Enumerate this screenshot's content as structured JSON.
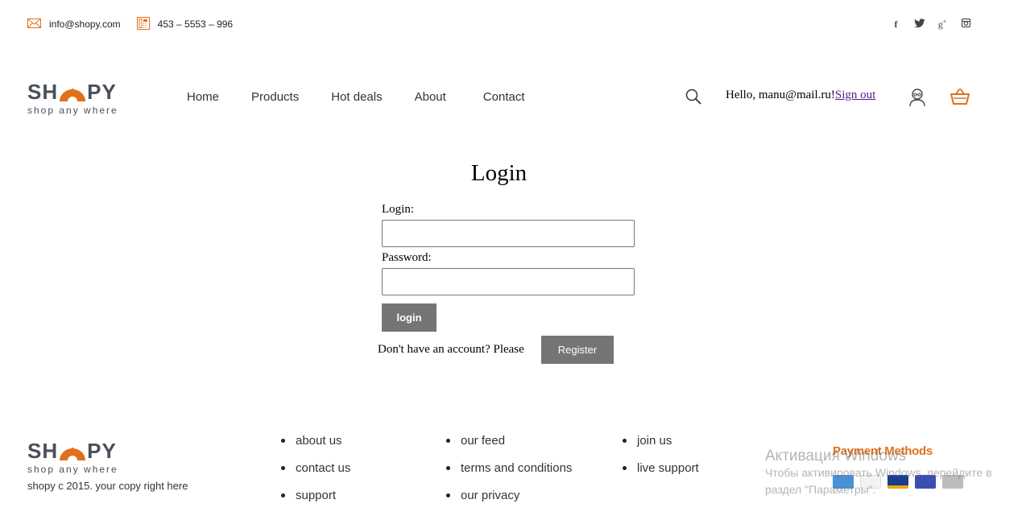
{
  "topbar": {
    "email": "info@shopy.com",
    "phone": "453 – 5553 – 996",
    "email_icon": "envelope-icon",
    "phone_icon": "phone-icon",
    "social": [
      {
        "name": "facebook-icon",
        "glyph": "f"
      },
      {
        "name": "twitter-icon",
        "glyph": "t"
      },
      {
        "name": "google-plus-icon",
        "glyph": "g+"
      },
      {
        "name": "instagram-icon",
        "glyph": "◙"
      }
    ]
  },
  "brand": {
    "name_left": "SH",
    "name_right": "PY",
    "tagline": "shop any where",
    "accent": "#e0701c",
    "dark": "#4a4f5a"
  },
  "nav": {
    "items": [
      "Home",
      "Products",
      "Hot deals",
      "About",
      "Contact"
    ]
  },
  "account": {
    "greeting": "Hello, manu@mail.ru!",
    "signout": "Sign out"
  },
  "login": {
    "title": "Login",
    "login_label": "Login:",
    "login_value": "",
    "password_label": "Password:",
    "password_value": "",
    "login_button": "login",
    "register_prompt": "Don't have an account? Please",
    "register_button": "Register"
  },
  "footer": {
    "copyright": "shopy c 2015. your copy right here",
    "col1": [
      "about us",
      "contact us",
      "support"
    ],
    "col2": [
      "our feed",
      "terms and conditions",
      "our privacy"
    ],
    "col3": [
      "join us",
      "live support"
    ],
    "payment_title": "Payment Methods",
    "cards": [
      "amex-card-icon",
      "discover-card-icon",
      "visa-card-icon",
      "mastercard-card-icon",
      "other-card-icon"
    ]
  },
  "windows_watermark": {
    "line1": "Активация Windows",
    "line2": "Чтобы активировать Windows, перейдите в",
    "line3": "раздел \"Параметры\"."
  }
}
